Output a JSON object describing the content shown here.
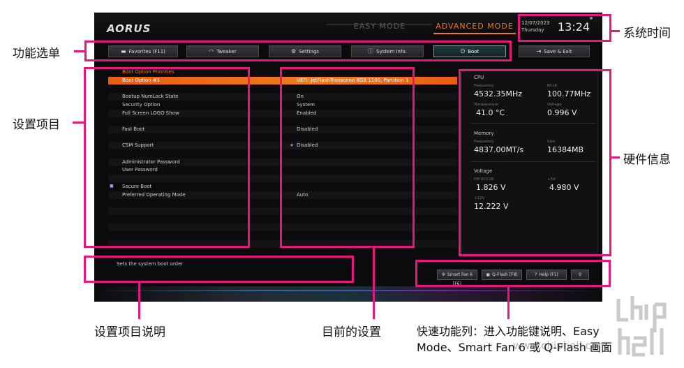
{
  "bios": {
    "brand": "AORUS",
    "modes": {
      "easy": "EASY MODE",
      "advanced": "ADVANCED MODE"
    },
    "clock": {
      "date": "12/07/2023",
      "day": "Thursday",
      "time": "13:24"
    },
    "tabs": [
      {
        "label": "Favorites (F11)",
        "icon": "folder-star-icon"
      },
      {
        "label": "Tweaker",
        "icon": "gauge-icon"
      },
      {
        "label": "Settings",
        "icon": "gear-icon"
      },
      {
        "label": "System Info.",
        "icon": "info-icon"
      },
      {
        "label": "Boot",
        "icon": "power-icon",
        "active": true
      },
      {
        "label": "Save & Exit",
        "icon": "exit-icon"
      }
    ],
    "settings": [
      {
        "label": "Boot Option Priorities",
        "value": "",
        "type": "header"
      },
      {
        "label": "Boot Option #1",
        "value": "UEFI: JetFlashTranscend 8GB 1100, Partition 1",
        "type": "selected"
      },
      {
        "label": "",
        "value": ""
      },
      {
        "label": "Bootup NumLock State",
        "value": "On"
      },
      {
        "label": "Security Option",
        "value": "System"
      },
      {
        "label": "Full Screen LOGO Show",
        "value": "Enabled"
      },
      {
        "label": "",
        "value": ""
      },
      {
        "label": "Fast Boot",
        "value": "Disabled"
      },
      {
        "label": "",
        "value": ""
      },
      {
        "label": "CSM Support",
        "value": "Disabled",
        "star": true
      },
      {
        "label": "",
        "value": ""
      },
      {
        "label": "Administrator Password",
        "value": ""
      },
      {
        "label": "User Password",
        "value": ""
      },
      {
        "label": "",
        "value": ""
      },
      {
        "label": "Secure Boot",
        "value": "",
        "mark": true
      },
      {
        "label": "Preferred Operating Mode",
        "value": "Auto"
      }
    ],
    "hardware": {
      "cpu": {
        "title": "CPU",
        "freq_label": "Frequency",
        "freq": "4532.35MHz",
        "bclk_label": "BCLK",
        "bclk": "100.77MHz",
        "temp_label": "Temperature",
        "temp": "41.0 °C",
        "volt_label": "Voltage",
        "volt": "0.996 V"
      },
      "memory": {
        "title": "Memory",
        "freq_label": "Frequency",
        "freq": "4837.00MT/s",
        "size_label": "Size",
        "size": "16384MB"
      },
      "voltage": {
        "title": "Voltage",
        "pm_label": "PM VCC18",
        "pm": "1.826 V",
        "v5_label": "+5V",
        "v5": "4.980 V",
        "v12_label": "+12V",
        "v12": "12.222 V"
      }
    },
    "description": "Sets the system boot order",
    "quick": [
      {
        "label": "Smart Fan 6 [F6]",
        "icon": "fan-icon"
      },
      {
        "label": "Q-Flash [F8]",
        "icon": "qflash-icon"
      },
      {
        "label": "Help (F1)",
        "icon": "help-icon"
      },
      {
        "label": "",
        "icon": "search-icon"
      }
    ]
  },
  "callouts": {
    "system_time": "系统时间",
    "menu": "功能选单",
    "setting_items": "设置项目",
    "hardware": "硬件信息",
    "item_desc": "设置项目说明",
    "current_setting": "目前的设置",
    "quick_bar_1": "快速功能列：进入功能键说明、Easy",
    "quick_bar_2": "Mode、Smart Fan 6 或 Q-Flash 画面"
  },
  "watermark": {
    "logo": "chip hell",
    "url": "www.chiphell.com"
  },
  "colors": {
    "callout": "#e6187d",
    "accent": "#f07b1e",
    "active_tab": "#5fa8a8"
  }
}
